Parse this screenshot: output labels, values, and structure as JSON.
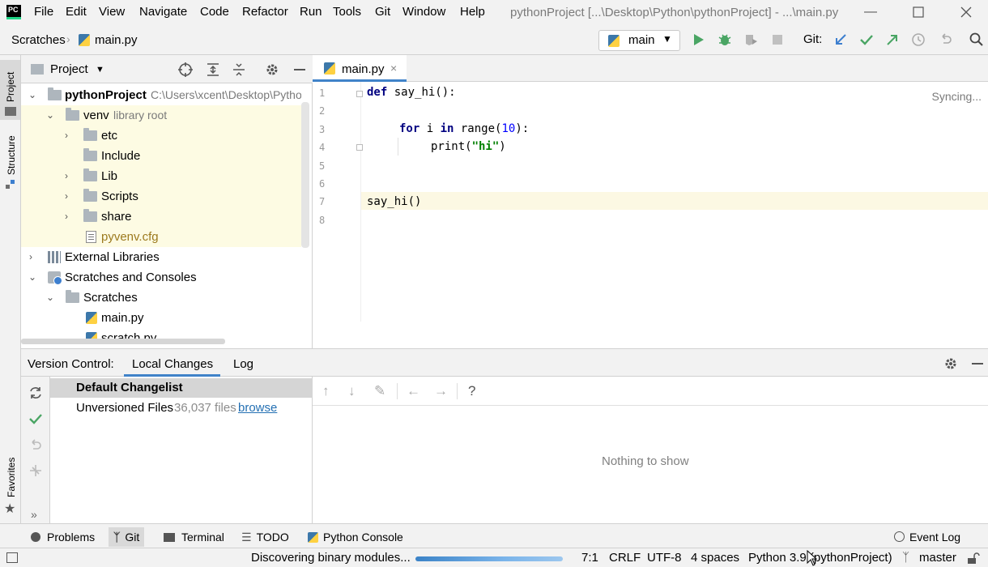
{
  "menubar": {
    "items": [
      "File",
      "Edit",
      "View",
      "Navigate",
      "Code",
      "Refactor",
      "Run",
      "Tools",
      "Git",
      "Window",
      "Help"
    ],
    "window_title": "pythonProject [...\\Desktop\\Python\\pythonProject] - ...\\main.py"
  },
  "navbar": {
    "crumbs": [
      "Scratches",
      "main.py"
    ],
    "run_config": "main",
    "git_label": "Git:"
  },
  "leftstrip": {
    "project": "Project",
    "structure": "Structure",
    "favorites": "Favorites"
  },
  "project": {
    "title": "Project",
    "tree": [
      {
        "label": "pythonProject",
        "hint": "C:\\Users\\xcent\\Desktop\\Pytho"
      },
      {
        "label": "venv",
        "hint": "library root"
      },
      {
        "label": "etc"
      },
      {
        "label": "Include"
      },
      {
        "label": "Lib"
      },
      {
        "label": "Scripts"
      },
      {
        "label": "share"
      },
      {
        "label": "pyvenv.cfg"
      },
      {
        "label": "External Libraries"
      },
      {
        "label": "Scratches and Consoles"
      },
      {
        "label": "Scratches"
      },
      {
        "label": "main.py"
      },
      {
        "label": "scratch.py"
      }
    ]
  },
  "editor": {
    "tab_label": "main.py",
    "status": "Syncing...",
    "line_numbers": [
      "1",
      "2",
      "3",
      "4",
      "5",
      "6",
      "7",
      "8"
    ],
    "code": {
      "l1_kw": "def",
      "l1_rest": " say_hi():",
      "l3_for": "for",
      "l3_i": " i ",
      "l3_in": "in",
      "l3_range": " range(",
      "l3_num": "10",
      "l3_end": "):",
      "l4_print": "print(",
      "l4_str": "\"hi\"",
      "l4_end": ")",
      "l7": "say_hi()"
    }
  },
  "vcs": {
    "title": "Version Control:",
    "tabs": [
      "Local Changes",
      "Log"
    ],
    "changelist": "Default Changelist",
    "unversioned_label": "Unversioned Files",
    "unversioned_count": "36,037 files",
    "browse": "browse",
    "empty": "Nothing to show"
  },
  "toolwindows": [
    "Problems",
    "Git",
    "Terminal",
    "TODO",
    "Python Console"
  ],
  "event_log": "Event Log",
  "status": {
    "task": "Discovering binary modules...",
    "position": "7:1",
    "line_sep": "CRLF",
    "encoding": "UTF-8",
    "indent": "4 spaces",
    "interpreter": "Python 3.9 (pythonProject)",
    "branch": "master",
    "progress": 0.6
  },
  "colors": {
    "accent": "#4083c9",
    "run_green": "#4aa564",
    "highlight": "#fdfbe3"
  }
}
